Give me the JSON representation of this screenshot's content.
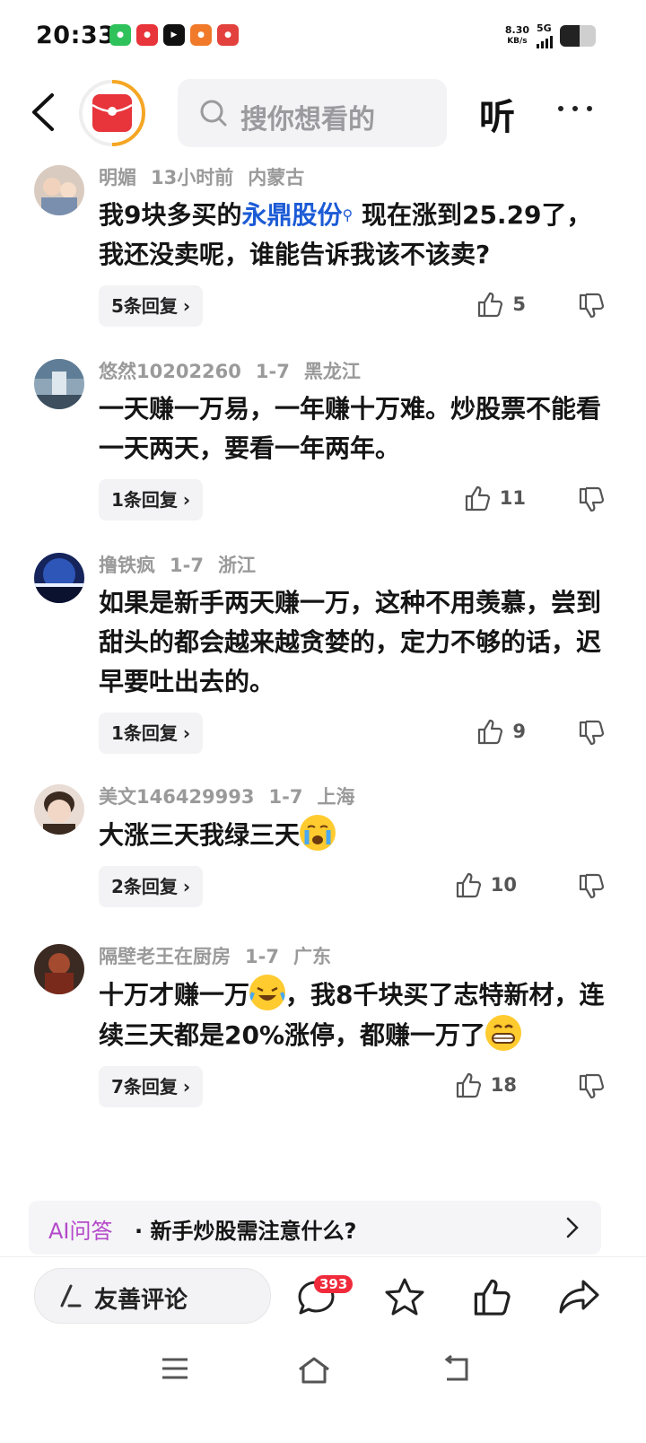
{
  "status_bar": {
    "time": "20:33",
    "net_speed_value": "8.30",
    "net_speed_unit": "KB/s",
    "network": "5G",
    "battery_level": 0.55
  },
  "header": {
    "search_placeholder": "搜你想看的",
    "listen_label": "听"
  },
  "comments": [
    {
      "user": "明媚",
      "time": "13小时前",
      "location": "内蒙古",
      "text_before": "我9块多买的",
      "stock": "永鼎股份",
      "text_after": " 现在涨到25.29了，我还没卖呢，谁能告诉我该不该卖?",
      "replies": "5条回复",
      "likes": "5"
    },
    {
      "user": "悠然10202260",
      "time": "1-7",
      "location": "黑龙江",
      "text": "一天赚一万易，一年赚十万难。炒股票不能看一天两天，要看一年两年。",
      "replies": "1条回复",
      "likes": "11"
    },
    {
      "user": "撸铁疯",
      "time": "1-7",
      "location": "浙江",
      "text": "如果是新手两天赚一万，这种不用羡慕，尝到甜头的都会越来越贪婪的，定力不够的话，迟早要吐出去的。",
      "replies": "1条回复",
      "likes": "9"
    },
    {
      "user": "美文146429993",
      "time": "1-7",
      "location": "上海",
      "text": "大涨三天我绿三天",
      "replies": "2条回复",
      "likes": "10"
    },
    {
      "user": "隔壁老王在厨房",
      "time": "1-7",
      "location": "广东",
      "text_part1": "十万才赚一万",
      "text_part2": "，我8千块买了志特新材，连续三天都是20%涨停，都赚一万了",
      "replies": "7条回复",
      "likes": "18"
    }
  ],
  "ai_bar": {
    "label": "AI问答",
    "question": "· 新手炒股需注意什么?"
  },
  "bottom_bar": {
    "comment_button": "友善评论",
    "comment_count": "393"
  }
}
